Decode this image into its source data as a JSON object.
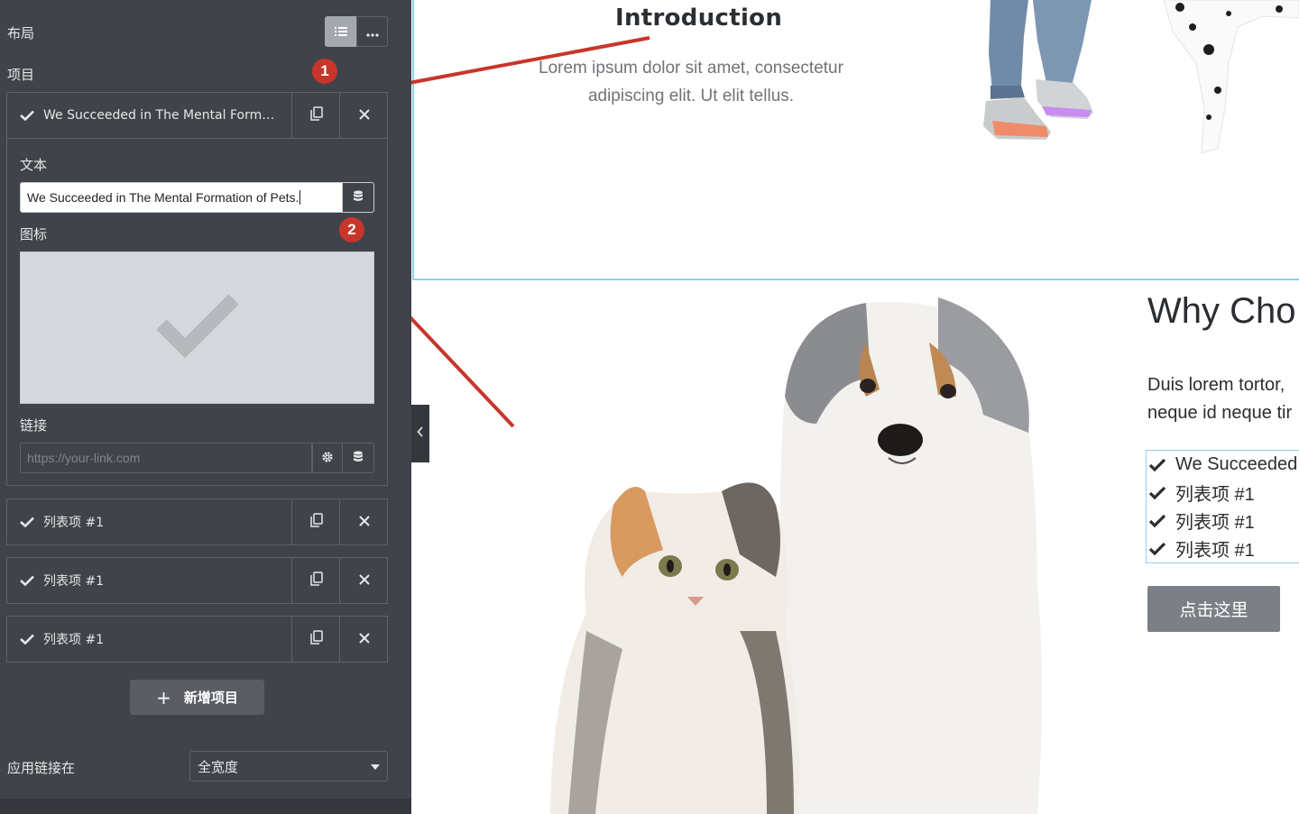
{
  "panel": {
    "layout_label": "布局",
    "items_label": "项目",
    "active_item": {
      "title": "We Succeeded in The Mental Formation of Pets.",
      "text_label": "文本",
      "text_value": "We Succeeded in The Mental Formation of Pets.",
      "icon_label": "图标",
      "link_label": "链接",
      "link_placeholder": "https://your-link.com"
    },
    "other_items": [
      {
        "title": "列表项 #1"
      },
      {
        "title": "列表项 #1"
      },
      {
        "title": "列表项 #1"
      }
    ],
    "add_item_label": "新增项目",
    "apply_link_label": "应用链接在",
    "apply_link_value": "全宽度"
  },
  "canvas": {
    "intro_title": "Introduction",
    "intro_text": "Lorem ipsum dolor sit amet, consectetur adipiscing elit. Ut elit tellus.",
    "why_title": "Why Cho",
    "why_text_line1": "Duis lorem tortor,",
    "why_text_line2": "neque id neque tir",
    "list": [
      "We Succeeded",
      "列表项 #1",
      "列表项 #1",
      "列表项 #1"
    ],
    "cta_label": "点击这里"
  },
  "annotations": {
    "marker1": "1",
    "marker2": "2"
  },
  "colors": {
    "panel_bg": "#404349",
    "accent_red": "#c8352b",
    "selection_blue": "#8fd0ef"
  }
}
